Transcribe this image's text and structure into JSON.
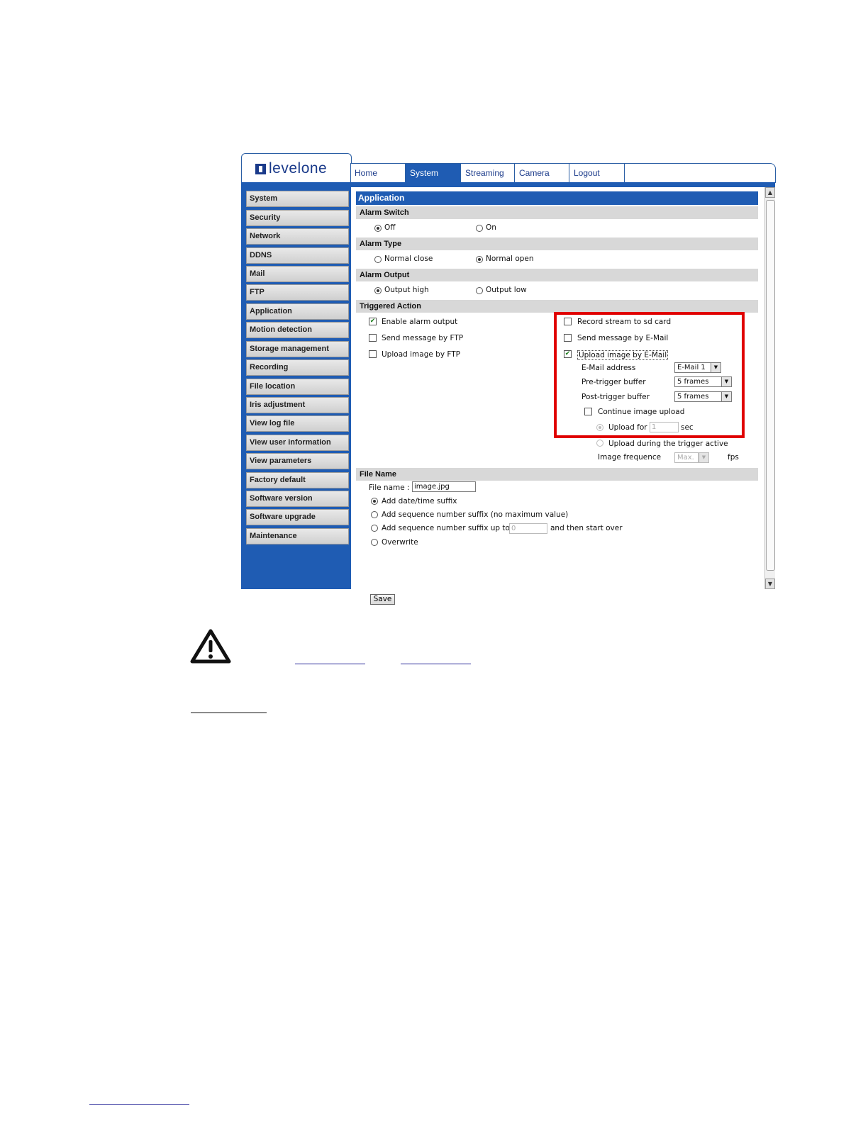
{
  "brand": {
    "logo_text": "levelone"
  },
  "tabs": [
    "Home",
    "System",
    "Streaming",
    "Camera",
    "Logout"
  ],
  "sidebar": {
    "items": [
      "System",
      "Security",
      "Network",
      "DDNS",
      "Mail",
      "FTP",
      "Application",
      "Motion detection",
      "Storage management",
      "Recording",
      "File location",
      "Iris adjustment",
      "View log file",
      "View user information",
      "View parameters",
      "Factory default",
      "Software version",
      "Software upgrade",
      "Maintenance"
    ]
  },
  "page": {
    "title": "Application",
    "alarm_switch": {
      "heading": "Alarm Switch",
      "off": "Off",
      "on": "On"
    },
    "alarm_type": {
      "heading": "Alarm Type",
      "normal_close": "Normal close",
      "normal_open": "Normal open"
    },
    "alarm_output": {
      "heading": "Alarm Output",
      "high": "Output high",
      "low": "Output low"
    },
    "triggered": {
      "heading": "Triggered Action",
      "enable_alarm_output": "Enable alarm output",
      "send_ftp": "Send message by FTP",
      "upload_ftp": "Upload image by FTP",
      "record_sd": "Record stream to sd card",
      "send_email": "Send message by E-Mail",
      "upload_email": "Upload image by E-Mail",
      "email_address_label": "E-Mail address",
      "email_address_value": "E-Mail 1",
      "pre_trigger_label": "Pre-trigger buffer",
      "pre_trigger_value": "5  frames",
      "post_trigger_label": "Post-trigger buffer",
      "post_trigger_value": "5  frames",
      "continue_upload": "Continue image upload",
      "upload_for": "Upload for",
      "upload_for_value": "1",
      "sec": "sec",
      "upload_during": "Upload during the trigger active",
      "image_frequence": "Image frequence",
      "frequence_value": "Max.",
      "fps": "fps"
    },
    "file_name": {
      "heading": "File Name",
      "label": "File name :",
      "value": "image.jpg",
      "opt_datetime": "Add date/time suffix",
      "opt_seq_nomax": "Add sequence number suffix (no maximum value)",
      "opt_seq_upto": "Add sequence number suffix up to",
      "seq_value": "0",
      "opt_seq_after": "and then start over",
      "opt_overwrite": "Overwrite"
    },
    "save_label": "Save"
  },
  "colors": {
    "brand_blue": "#1f5cb3",
    "highlight_red": "#e00000"
  }
}
